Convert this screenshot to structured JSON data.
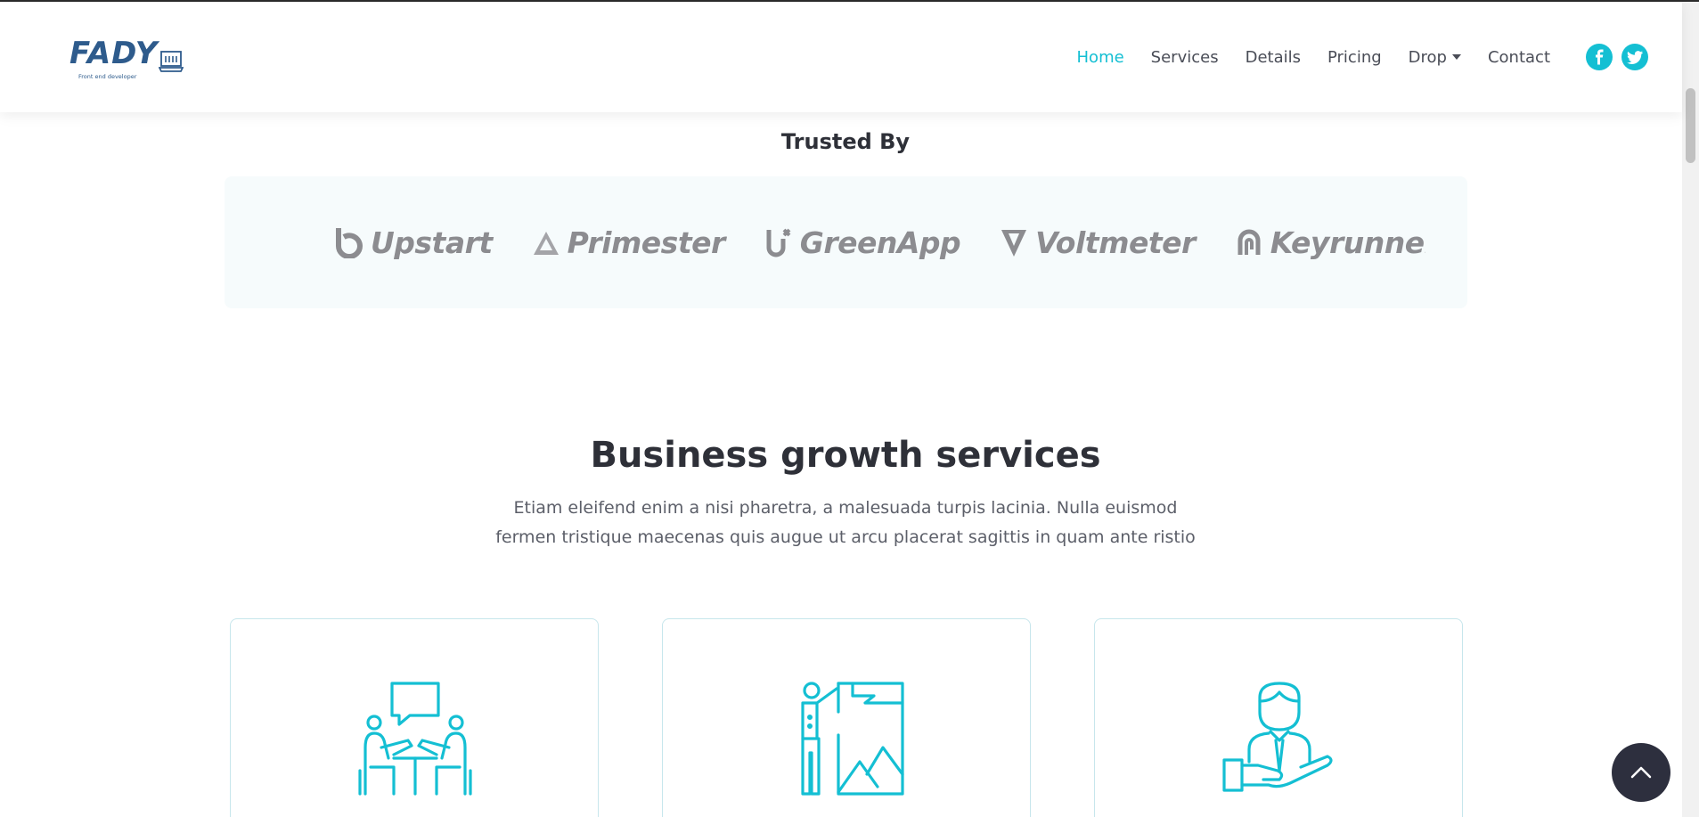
{
  "brand": {
    "name": "FADY",
    "tagline": "Front end developer",
    "primary_color": "#14bfd3",
    "logo_color": "#2e5b8c"
  },
  "nav": {
    "items": [
      {
        "label": "Home",
        "active": true
      },
      {
        "label": "Services"
      },
      {
        "label": "Details"
      },
      {
        "label": "Pricing"
      },
      {
        "label": "Drop",
        "dropdown": true
      },
      {
        "label": "Contact"
      }
    ],
    "socials": [
      {
        "icon": "facebook-icon",
        "glyph": "f"
      },
      {
        "icon": "twitter-icon",
        "glyph": "t"
      }
    ]
  },
  "trusted": {
    "title": "Trusted By",
    "logos": [
      {
        "name": "Upstart",
        "icon": "upstart-logo-icon"
      },
      {
        "name": "Primester",
        "icon": "primester-logo-icon"
      },
      {
        "name": "GreenApp",
        "icon": "greenapp-logo-icon"
      },
      {
        "name": "Voltmeter",
        "icon": "voltmeter-logo-icon"
      },
      {
        "name": "Keyrunner",
        "icon": "keyrunner-logo-icon"
      }
    ]
  },
  "services": {
    "title": "Business growth services",
    "subtitle": "Etiam eleifend enim a nisi pharetra, a malesuada turpis lacinia. Nulla euismod fermen tristique maecenas quis augue ut arcu placerat sagittis in quam ante ristio",
    "cards": [
      {
        "icon": "meeting-icon"
      },
      {
        "icon": "presentation-icon"
      },
      {
        "icon": "customer-care-icon"
      }
    ]
  },
  "back_to_top": {
    "icon": "chevron-up-icon"
  }
}
